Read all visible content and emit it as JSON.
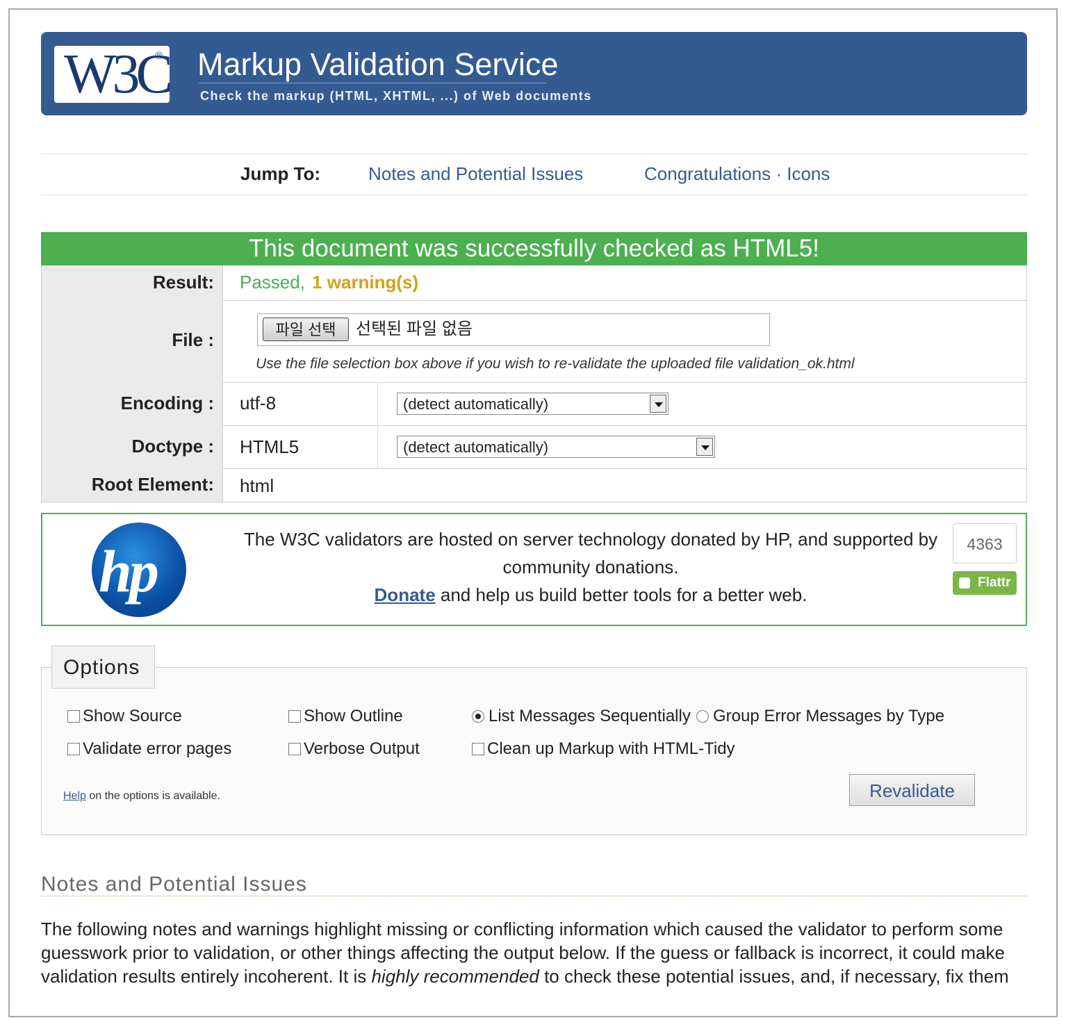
{
  "header": {
    "logo_text": "W3C",
    "logo_mark": "®",
    "title": "Markup Validation Service",
    "subtitle": "Check the markup (HTML, XHTML, ...) of Web documents"
  },
  "jump": {
    "label": "Jump To:",
    "links": [
      "Notes and Potential Issues",
      "Congratulations · Icons"
    ]
  },
  "status": {
    "banner": "This document was successfully checked as HTML5!",
    "color": "#4caf50"
  },
  "results": {
    "result_label": "Result:",
    "result_passed": "Passed,",
    "result_warnings": "1 warning(s)",
    "file_label": "File :",
    "file_button": "파일 선택",
    "file_none": "선택된 파일 없음",
    "file_note": "Use the file selection box above if you wish to re-validate the uploaded file validation_ok.html",
    "encoding_label": "Encoding :",
    "encoding_value": "utf-8",
    "encoding_select": "(detect automatically)",
    "doctype_label": "Doctype :",
    "doctype_value": "HTML5",
    "doctype_select": "(detect automatically)",
    "root_label": "Root Element:",
    "root_value": "html"
  },
  "sponsor": {
    "logo_text": "hp",
    "line1": "The W3C validators are hosted on server technology donated by HP, and supported by community donations.",
    "donate_link": "Donate",
    "line2": "and help us build better tools for a better web.",
    "flattr_count": "4363",
    "flattr_label": "Flattr"
  },
  "options": {
    "legend": "Options",
    "show_source": "Show Source",
    "show_outline": "Show Outline",
    "list_sequential": "List Messages Sequentially",
    "group_by_type": "Group Error Messages by Type",
    "validate_error_pages": "Validate error pages",
    "verbose_output": "Verbose Output",
    "cleanup_tidy": "Clean up Markup with HTML-Tidy",
    "help_link": "Help",
    "help_text": "on the options is available.",
    "revalidate": "Revalidate"
  },
  "notes": {
    "heading": "Notes and Potential Issues",
    "para_start": "The following notes and warnings highlight missing or conflicting information which caused the validator to perform some guesswork prior to validation, or other things affecting the output below. If the guess or fallback is incorrect, it could make validation results entirely incoherent. It is",
    "para_emphasis": "highly recommended",
    "para_end": "to check these potential issues, and, if necessary, fix them"
  },
  "colors": {
    "brand_blue": "#335b92",
    "success_green": "#4caf50",
    "warning_gold": "#d4a017"
  }
}
